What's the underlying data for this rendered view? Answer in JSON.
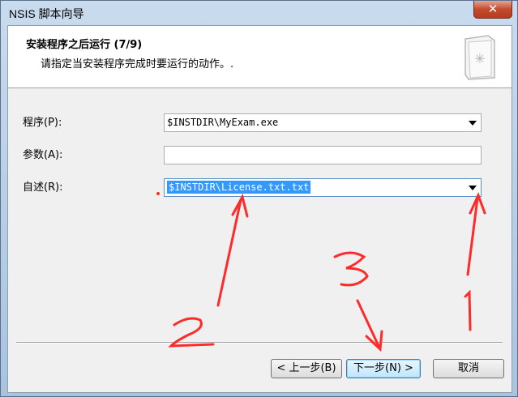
{
  "window": {
    "title": "NSIS 脚本向导",
    "close_glyph": "✕"
  },
  "header": {
    "title": "安装程序之后运行 (7/9)",
    "subtitle": "请指定当安装程序完成时要运行的动作。.",
    "icon": "document-wizard-icon"
  },
  "form": {
    "program_label": "程序(P):",
    "program_value": "$INSTDIR\\MyExam.exe",
    "params_label": "参数(A):",
    "params_value": "",
    "readme_label": "自述(R):",
    "readme_value": "$INSTDIR\\License.txt.txt"
  },
  "buttons": {
    "back": "< 上一步(B)",
    "next": "下一步(N) >",
    "cancel": "取消"
  },
  "annotations": {
    "a1": "1",
    "a2": "2",
    "a3": "3",
    "color": "#ff2020"
  }
}
